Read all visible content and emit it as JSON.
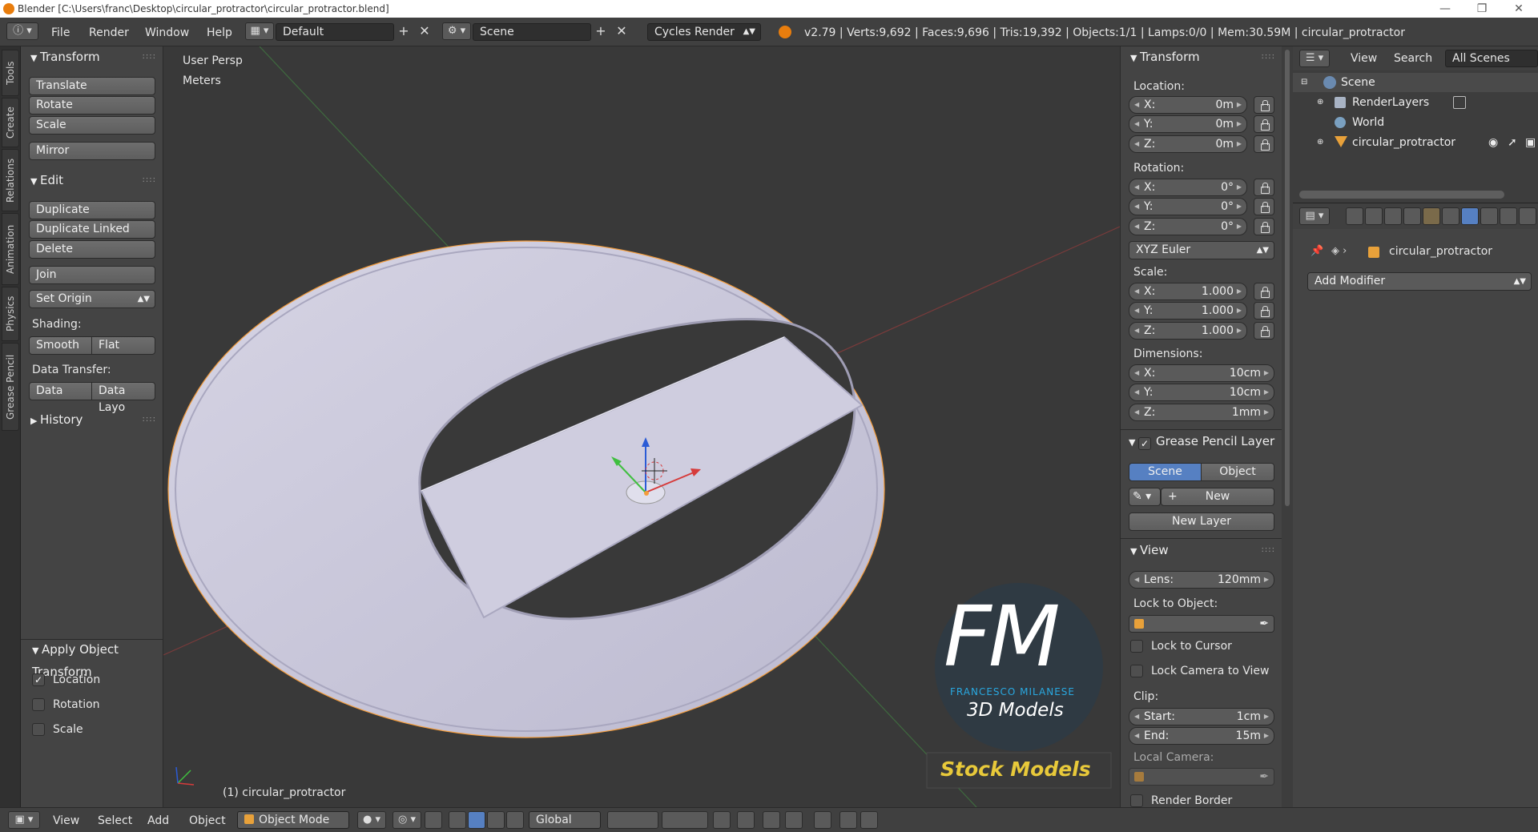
{
  "window": {
    "title": "Blender [C:\\Users\\franc\\Desktop\\circular_protractor\\circular_protractor.blend]",
    "controls": [
      "—",
      "❐",
      "✕"
    ]
  },
  "topbar": {
    "menus": [
      "File",
      "Render",
      "Window",
      "Help"
    ],
    "layout": "Default",
    "scene": "Scene",
    "engine": "Cycles Render",
    "stats": "v2.79 | Verts:9,692 | Faces:9,696 | Tris:19,392 | Objects:1/1 | Lamps:0/0 | Mem:30.59M | circular_protractor"
  },
  "toolstabs": [
    "Tools",
    "Create",
    "Relations",
    "Animation",
    "Physics",
    "Grease Pencil"
  ],
  "left": {
    "transform_title": "Transform",
    "translate": "Translate",
    "rotate": "Rotate",
    "scale": "Scale",
    "mirror": "Mirror",
    "edit_title": "Edit",
    "duplicate": "Duplicate",
    "duplicate_linked": "Duplicate Linked",
    "delete": "Delete",
    "join": "Join",
    "set_origin": "Set Origin",
    "shading_label": "Shading:",
    "smooth": "Smooth",
    "flat": "Flat",
    "data_transfer_label": "Data Transfer:",
    "data": "Data",
    "data_layout": "Data Layo",
    "history_title": "History",
    "apply_title": "Apply Object Transform",
    "apply_location": "Location",
    "apply_rotation": "Rotation",
    "apply_scale": "Scale"
  },
  "viewport": {
    "view_name": "User Persp",
    "units": "Meters",
    "object_label": "(1) circular_protractor",
    "watermark_main": "FM",
    "watermark_name": "FRANCESCO MILANESE",
    "watermark_sub": "3D Models",
    "watermark_stock": "Stock Models"
  },
  "n_panel": {
    "transform_title": "Transform",
    "location_label": "Location:",
    "loc": [
      {
        "axis": "X:",
        "value": "0m"
      },
      {
        "axis": "Y:",
        "value": "0m"
      },
      {
        "axis": "Z:",
        "value": "0m"
      }
    ],
    "rotation_label": "Rotation:",
    "rot": [
      {
        "axis": "X:",
        "value": "0°"
      },
      {
        "axis": "Y:",
        "value": "0°"
      },
      {
        "axis": "Z:",
        "value": "0°"
      }
    ],
    "rotation_mode": "XYZ Euler",
    "scale_label": "Scale:",
    "scl": [
      {
        "axis": "X:",
        "value": "1.000"
      },
      {
        "axis": "Y:",
        "value": "1.000"
      },
      {
        "axis": "Z:",
        "value": "1.000"
      }
    ],
    "dimensions_label": "Dimensions:",
    "dim": [
      {
        "axis": "X:",
        "value": "10cm"
      },
      {
        "axis": "Y:",
        "value": "10cm"
      },
      {
        "axis": "Z:",
        "value": "1mm"
      }
    ],
    "gp_title": "Grease Pencil Layer",
    "gp_scene": "Scene",
    "gp_object": "Object",
    "gp_new": "New",
    "gp_new_layer": "New Layer",
    "view_title": "View",
    "lens_label": "Lens:",
    "lens_value": "120mm",
    "lock_to_object_label": "Lock to Object:",
    "lock_to_cursor": "Lock to Cursor",
    "lock_camera": "Lock Camera to View",
    "clip_label": "Clip:",
    "clip_start_label": "Start:",
    "clip_start_value": "1cm",
    "clip_end_label": "End:",
    "clip_end_value": "15m",
    "local_camera_label": "Local Camera:",
    "render_border": "Render Border"
  },
  "outliner": {
    "menus": [
      "View",
      "Search"
    ],
    "filter": "All Scenes",
    "rows": [
      "Scene",
      "RenderLayers",
      "World",
      "circular_protractor"
    ]
  },
  "properties": {
    "object_name": "circular_protractor",
    "add_modifier": "Add Modifier"
  },
  "bottombar": {
    "menus": [
      "View",
      "Select",
      "Add",
      "Object"
    ],
    "mode": "Object Mode",
    "orientation": "Global"
  },
  "colors": {
    "accent_blue": "#5680c2",
    "selection_orange": "#f39c3c",
    "watermark_blue": "#29a8e0",
    "watermark_yellow": "#e8c93a"
  }
}
